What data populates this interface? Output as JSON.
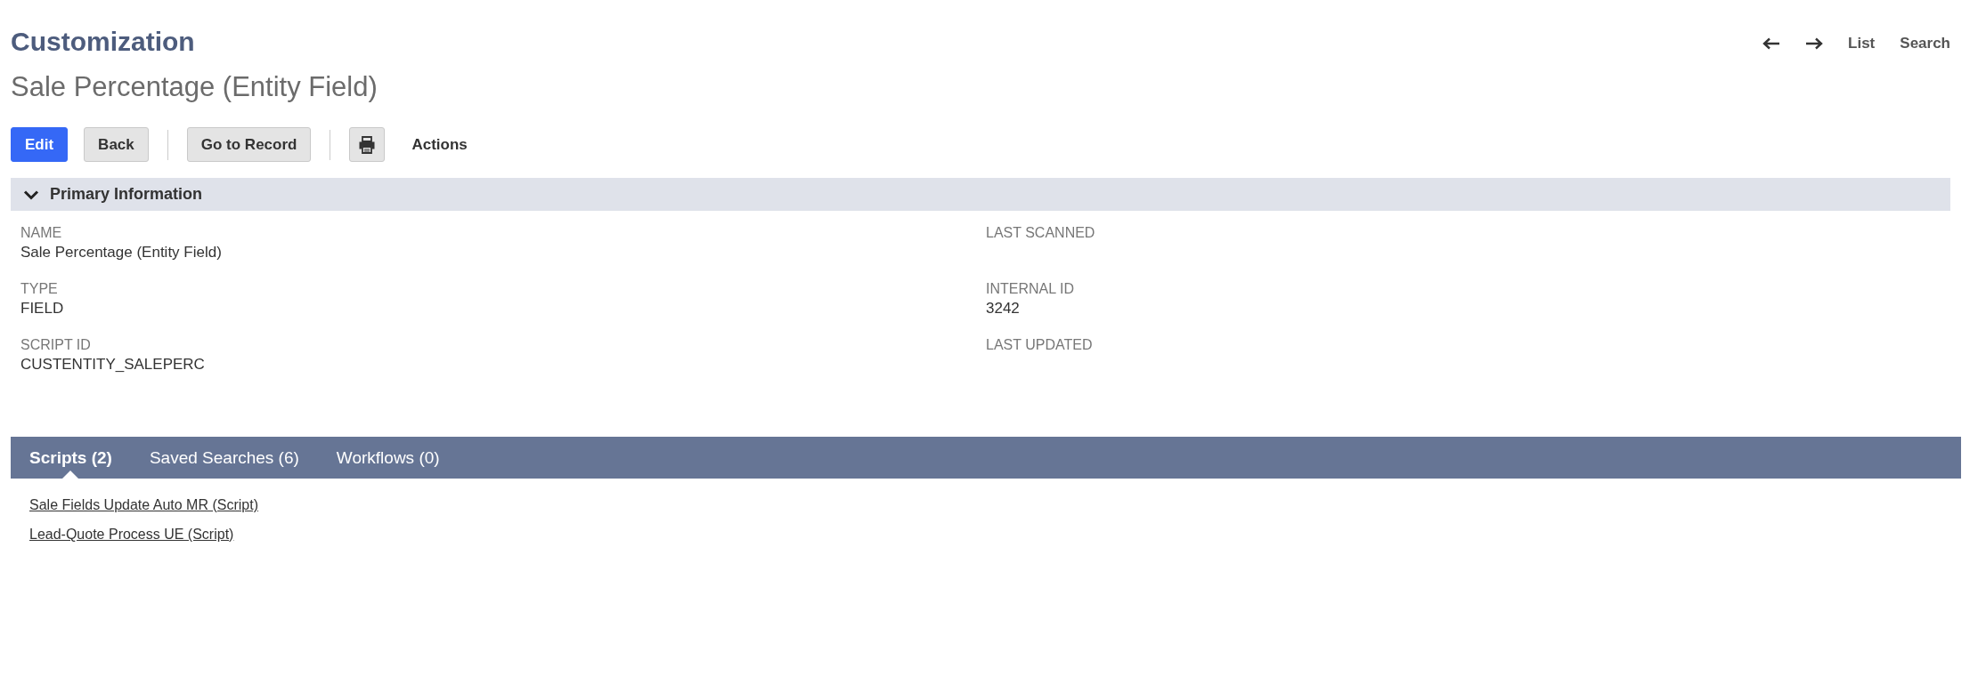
{
  "header": {
    "title": "Customization",
    "subtitle": "Sale Percentage (Entity Field)"
  },
  "nav": {
    "links": [
      "List",
      "Search"
    ]
  },
  "toolbar": [
    {
      "kind": "primary",
      "label": "Edit"
    },
    {
      "kind": "secondary",
      "label": "Back"
    },
    {
      "kind": "separator"
    },
    {
      "kind": "secondary",
      "label": "Go to Record"
    },
    {
      "kind": "separator"
    },
    {
      "kind": "print"
    },
    {
      "kind": "menu",
      "label": "Actions"
    }
  ],
  "section": {
    "title": "Primary Information",
    "expanded": true,
    "columns": [
      [
        {
          "label": "NAME",
          "value": "Sale Percentage (Entity Field)"
        },
        {
          "label": "TYPE",
          "value": "FIELD"
        },
        {
          "label": "SCRIPT ID",
          "value": "CUSTENTITY_SALEPERC"
        }
      ],
      [
        {
          "label": "LAST SCANNED"
        },
        {
          "label": "INTERNAL ID",
          "value": "3242"
        },
        {
          "label": "LAST UPDATED"
        }
      ]
    ]
  },
  "tabs": [
    {
      "label": "Scripts (2)",
      "selected": true
    },
    {
      "label": "Saved Searches (6)",
      "selected": false
    },
    {
      "label": "Workflows (0)",
      "selected": false
    }
  ],
  "tab_content": {
    "links": [
      "Sale Fields Update Auto MR (Script)",
      "Lead-Quote Process UE (Script)"
    ]
  }
}
